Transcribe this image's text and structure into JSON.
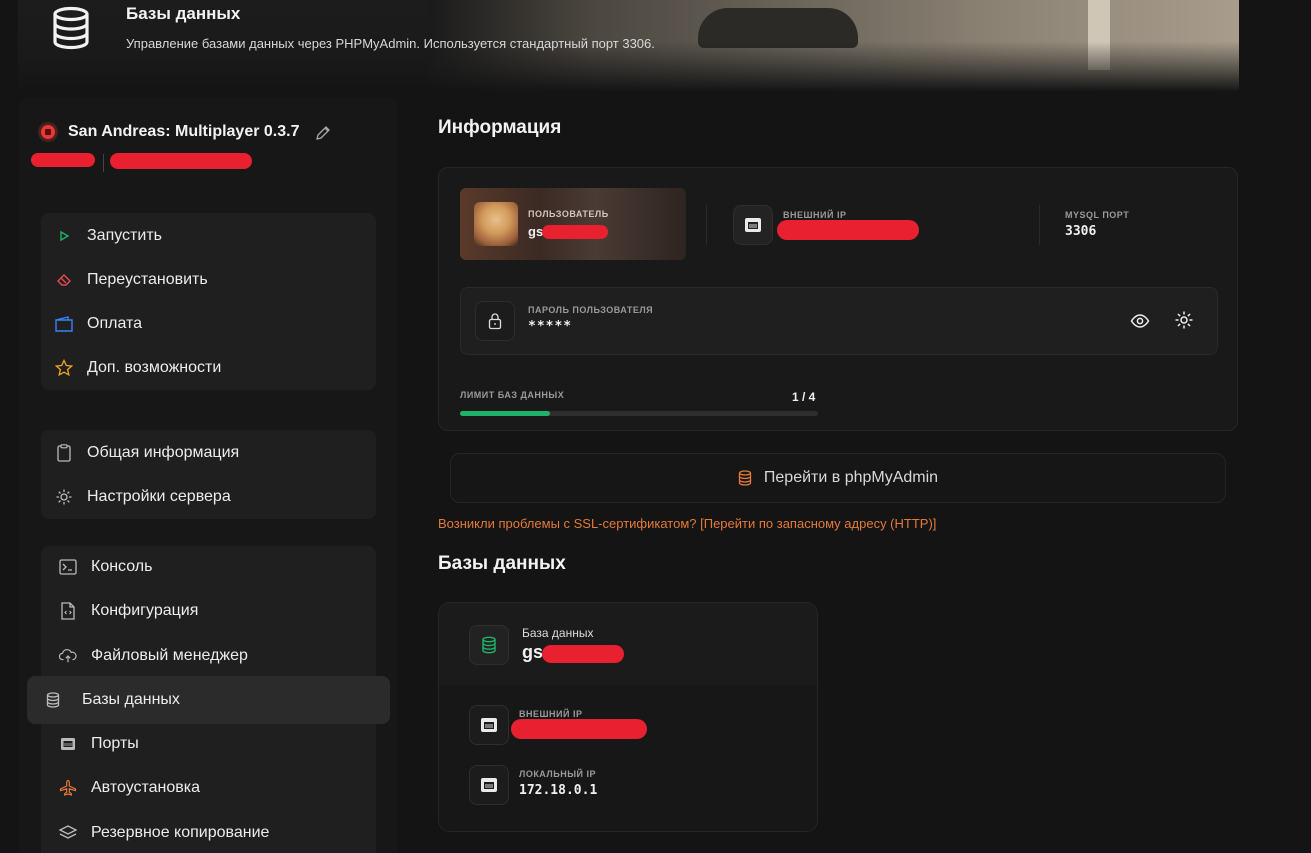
{
  "header": {
    "title": "Базы данных",
    "subtitle": "Управление базами данных через PHPMyAdmin. Используется стандартный порт 3306.",
    "icon": "database-icon"
  },
  "server": {
    "name": "San Andreas: Multiplayer 0.3.7",
    "status_color": "#e53935"
  },
  "sidebar": {
    "actions": [
      {
        "label": "Запустить",
        "icon": "play-icon",
        "color": "#20b26b"
      },
      {
        "label": "Переустановить",
        "icon": "eraser-icon",
        "color": "#e5484d"
      },
      {
        "label": "Оплата",
        "icon": "wallet-icon",
        "color": "#3b82f6"
      },
      {
        "label": "Доп. возможности",
        "icon": "star-icon",
        "color": "#f5a623"
      }
    ],
    "info": [
      {
        "label": "Общая информация",
        "icon": "clipboard-icon"
      },
      {
        "label": "Настройки сервера",
        "icon": "gear-icon"
      }
    ],
    "nav": [
      {
        "label": "Консоль",
        "icon": "terminal-icon"
      },
      {
        "label": "Конфигурация",
        "icon": "config-file-icon"
      },
      {
        "label": "Файловый менеджер",
        "icon": "cloud-upload-icon"
      },
      {
        "label": "Базы данных",
        "icon": "database-icon",
        "active": true
      },
      {
        "label": "Порты",
        "icon": "ethernet-icon"
      },
      {
        "label": "Автоустановка",
        "icon": "plane-icon",
        "color": "#e37a3a"
      },
      {
        "label": "Резервное копирование",
        "icon": "layers-icon"
      }
    ]
  },
  "info_section": {
    "title": "Информация",
    "user_label": "ПОЛЬЗОВАТЕЛЬ",
    "user_value": "gs",
    "external_ip_label": "ВНЕШНИЙ IP",
    "mysql_port_label": "MYSQL ПОРТ",
    "mysql_port_value": "3306",
    "password_label": "ПАРОЛЬ ПОЛЬЗОВАТЕЛЯ",
    "password_value": "*****",
    "limit_label": "ЛИМИТ БАЗ ДАННЫХ",
    "limit_value": "1 / 4",
    "limit_fraction": 0.25,
    "accent": "#20b26b"
  },
  "phpmyadmin_button": "Перейти в phpMyAdmin",
  "ssl_note": "Возникли проблемы с SSL-сертификатом? [Перейти по запасному адресу (HTTP)]",
  "databases_section": {
    "title": "Базы данных",
    "db_label": "База данных",
    "db_name": "gs",
    "external_ip_label": "ВНЕШНИЙ IP",
    "local_ip_label": "ЛОКАЛЬНЫЙ IP",
    "local_ip_value": "172.18.0.1"
  }
}
